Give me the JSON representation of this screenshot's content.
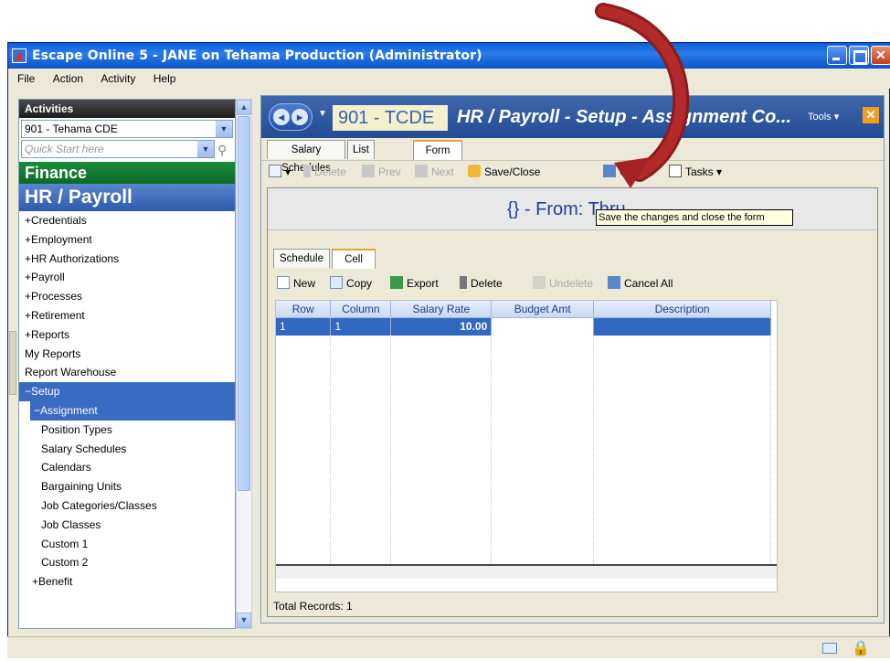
{
  "window": {
    "title": "Escape Online 5 - JANE on Tehama Production (Administrator)"
  },
  "menu": {
    "file": "File",
    "action": "Action",
    "activity": "Activity",
    "help": "Help"
  },
  "left": {
    "activities_title": "Activities",
    "org_select": "901 - Tehama CDE",
    "quick_start_placeholder": "Quick Start here",
    "finance": "Finance",
    "hr_payroll": "HR / Payroll",
    "items": [
      "+Credentials",
      "+Employment",
      "+HR Authorizations",
      "+Payroll",
      "+Processes",
      "+Retirement",
      "+Reports",
      "My Reports",
      "Report Warehouse",
      "−Setup",
      "−Assignment",
      "Position Types",
      "Salary Schedules",
      "Calendars",
      "Bargaining Units",
      "Job Categories/Classes",
      "Job Classes",
      "Custom 1",
      "Custom 2",
      "+Benefit"
    ]
  },
  "header": {
    "code": "901 - TCDE",
    "title": "HR / Payroll - Setup - Assignment Co...",
    "tools": "Tools ▾"
  },
  "tabs": [
    "Salary Schedules",
    "List",
    "Form"
  ],
  "toolbar": {
    "delete": "Delete",
    "prev": "Prev",
    "next": "Next",
    "save_close": "Save/Close",
    "cancel": "Cancel",
    "tasks": "Tasks"
  },
  "banner": "{} -  From:  Thru",
  "tooltip": "Save the changes and close the form",
  "subtabs": [
    "Schedule",
    "Cell"
  ],
  "toolbar2": {
    "new": "New",
    "copy": "Copy",
    "export": "Export",
    "delete": "Delete",
    "undelete": "Undelete",
    "cancel_all": "Cancel All"
  },
  "grid": {
    "columns": [
      "Row",
      "Column",
      "Salary Rate",
      "Budget Amt",
      "Description"
    ],
    "rows": [
      [
        "1",
        "1",
        "10.00",
        "",
        ""
      ]
    ]
  },
  "total_records": "Total Records: 1",
  "colors": {
    "accent_blue": "#3368c2",
    "finance_green": "#0b6a25",
    "arrow_red": "#9b1c1c"
  }
}
